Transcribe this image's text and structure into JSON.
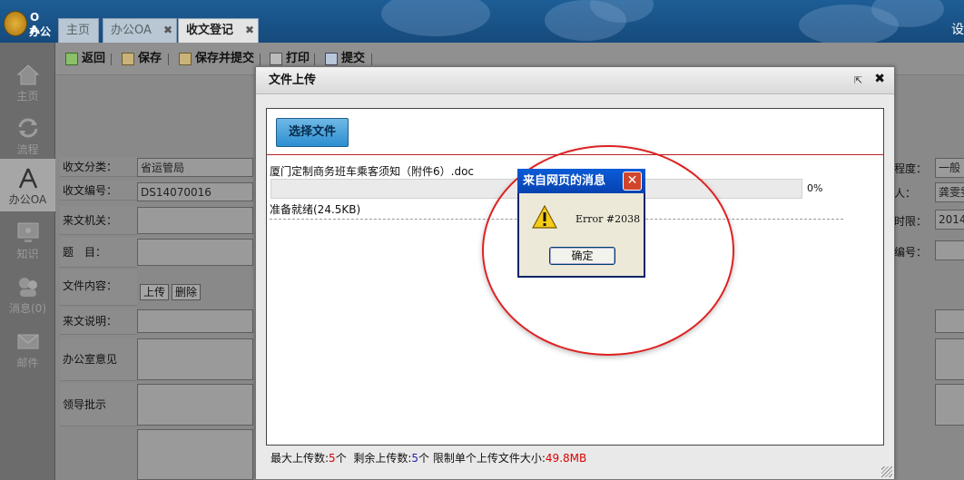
{
  "header": {
    "logo_top": "O A",
    "logo_bottom": "办公",
    "right_glyph": "设"
  },
  "tabs": [
    {
      "label": "主页"
    },
    {
      "label": "办公OA",
      "close": "✖"
    },
    {
      "label": "收文登记",
      "close": "✖"
    }
  ],
  "sidebar": {
    "items": [
      {
        "label": "主页",
        "icon": "home-icon"
      },
      {
        "label": "流程",
        "icon": "refresh-icon"
      },
      {
        "label": "办公OA",
        "icon": "compass-icon"
      },
      {
        "label": "知识",
        "icon": "monitor-icon"
      },
      {
        "label": "消息(0)",
        "icon": "user-message-icon"
      },
      {
        "label": "邮件",
        "icon": "mail-icon"
      }
    ]
  },
  "toolbar": {
    "back": "返回",
    "save": "保存",
    "save_submit": "保存并提交",
    "print": "打印",
    "submit": "提交"
  },
  "form": {
    "category_label": "收文分类：",
    "category_value": "省运管局",
    "number_label": "收文编号：",
    "number_value": "DS14070016",
    "sender_label": "来文机关：",
    "subject_label": "题　目：",
    "content_label": "文件内容：",
    "upload_btn": "上传",
    "delete_btn": "删除",
    "desc_label": "来文说明：",
    "office_label": "办公室意见",
    "leader_label": "领导批示",
    "right": [
      {
        "label": "程度：",
        "value": "一般"
      },
      {
        "label": "人：",
        "value": "龚雯雯"
      },
      {
        "label": "时限：",
        "value": "2014-"
      },
      {
        "label": "编号：",
        "value": ""
      }
    ]
  },
  "upload_dialog": {
    "title": "文件上传",
    "max_icon": "⇱",
    "close_icon": "✖",
    "select_button": "选择文件",
    "file_name": "厦门定制商务班车乘客须知（附件6）.doc",
    "progress_percent": "0%",
    "progress_value": 0,
    "status": "准备就绪(24.5KB)",
    "footer": {
      "max_label": "最大上传数:",
      "max_value": "5",
      "max_unit": "个",
      "remain_label": "剩余上传数:",
      "remain_value": "5",
      "remain_unit": "个",
      "limit_label": "限制单个上传文件大小:",
      "limit_value": "49.8MB"
    }
  },
  "alert": {
    "title": "来自网页的消息",
    "close": "✕",
    "message": "Error #2038",
    "ok": "确定"
  },
  "colors": {
    "annotation": "#dd2222",
    "alert_title": "#0a4fc8",
    "select_button": "#3d9ad6"
  }
}
